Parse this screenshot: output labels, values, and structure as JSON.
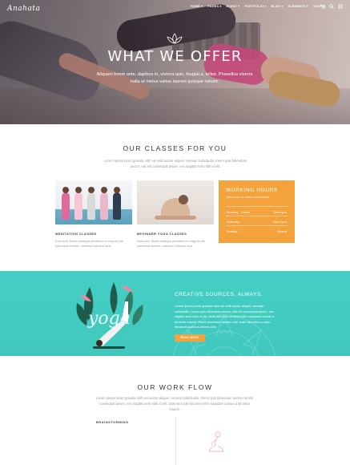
{
  "brand": {
    "logo": "Anahata"
  },
  "nav": {
    "items": [
      "HOME ▾",
      "PAGES ▾",
      "EVENT ▾",
      "PORTFOLIO ▾",
      "BLOG ▾",
      "ELEMENTS ▾",
      "SHOP ▾"
    ],
    "icons": [
      "cart-icon",
      "search-icon",
      "menu-icon"
    ]
  },
  "hero": {
    "title": "WHAT WE OFFER",
    "subtitle": "Aliquam lorem ante, dapibus in, viverra quis, feugiat a, tellus. Phasellus viverra nulla ut metus varius laoreet quisque rutrum."
  },
  "classes": {
    "title": "OUR CLASSES FOR YOU",
    "text": "Lorem ipsum proin gravida nibh vel velit auctor aliquet. Aenean sollicitudin, lorem quis bibendum auctor, nisi elit consequat ipsum, nec sagittis sem nibh id elit.",
    "cards": [
      {
        "label": "MEDITATION CLASSES",
        "text": "Duis sunt. Morie tuttisque penatibus et mag nis dis parturient montes, nascetur ridiculus mus."
      },
      {
        "label": "BEGINNER YOGA CLASSES",
        "text": "Duis sunt. Morie tuttisque penatibus et mag nis dis parturient montes, nascetur ridiculus mus."
      }
    ],
    "hours": {
      "title": "WORKING HOURS",
      "subtitle": "Visit us at our office some times",
      "rows": [
        {
          "day": "Monday - Friday",
          "time": "9am-5pm"
        },
        {
          "day": "Saturday",
          "time": "9am-1pm"
        },
        {
          "day": "Sunday",
          "time": "Closed"
        }
      ]
    }
  },
  "creative": {
    "title": "CREATIVE SOURCES, ALWAYS.",
    "text": "Lorem ipsum proin gravida nibh vel velit auctor aliquet. Aenean sollicitudin, lorem quis bibendum auctor, nisi elit consequat ipsum, nec sagittis sem nibh id elit. Duis sed odio sit amet nibh vulputate cursus a sit amet mauris. Morbi accumsan ipsum velit. Nam nec tellus a odio tincidunt auctor a ornare odio.",
    "button": "READ MORE",
    "art_word": "yoga"
  },
  "workflow": {
    "title": "OUR WORK FLOW",
    "text": "Lorem ipsum amet gravida nibh vel auctor aliquet. Aenean sollicitudin, lorem quis bibendum auctor nisi elit consequat ipsum, nec sagittis sem nibh id elit. Duis sed odio sit amet nibh vulputate cursus a sit amet mauris.",
    "step": "BRAINSTORMING"
  },
  "colors": {
    "accent_orange": "#f4a23b",
    "teal": "#45cfc4",
    "pink_icon": "#f0b9c7"
  }
}
